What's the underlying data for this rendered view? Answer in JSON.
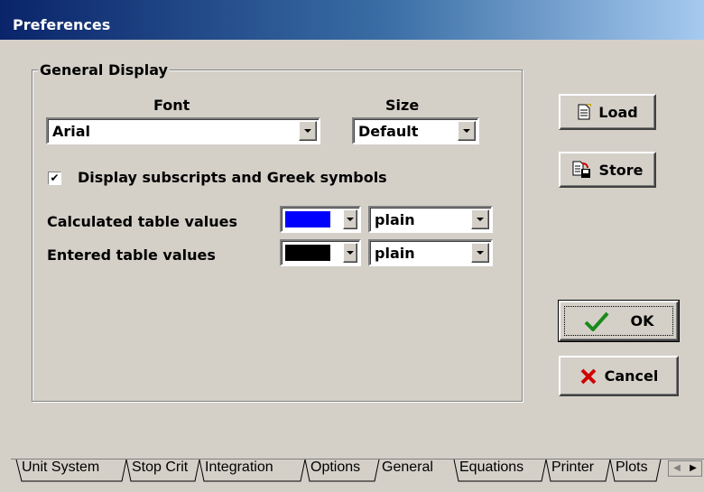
{
  "window": {
    "title": "Preferences"
  },
  "group": {
    "title": "General Display",
    "font_label": "Font",
    "size_label": "Size",
    "font_value": "Arial",
    "size_value": "Default",
    "checkbox_label": "Display subscripts and Greek symbols",
    "checkbox_checked": true,
    "calculated_label": "Calculated table values",
    "calculated_color": "#0000ff",
    "calculated_style": "plain",
    "entered_label": "Entered table values",
    "entered_color": "#000000",
    "entered_style": "plain"
  },
  "buttons": {
    "load": "Load",
    "store": "Store",
    "ok": "OK",
    "cancel": "Cancel"
  },
  "tabs": [
    "Unit System",
    "Stop Crit",
    "Integration",
    "Options",
    "General",
    "Equations",
    "Printer",
    "Plots"
  ],
  "active_tab": "General"
}
